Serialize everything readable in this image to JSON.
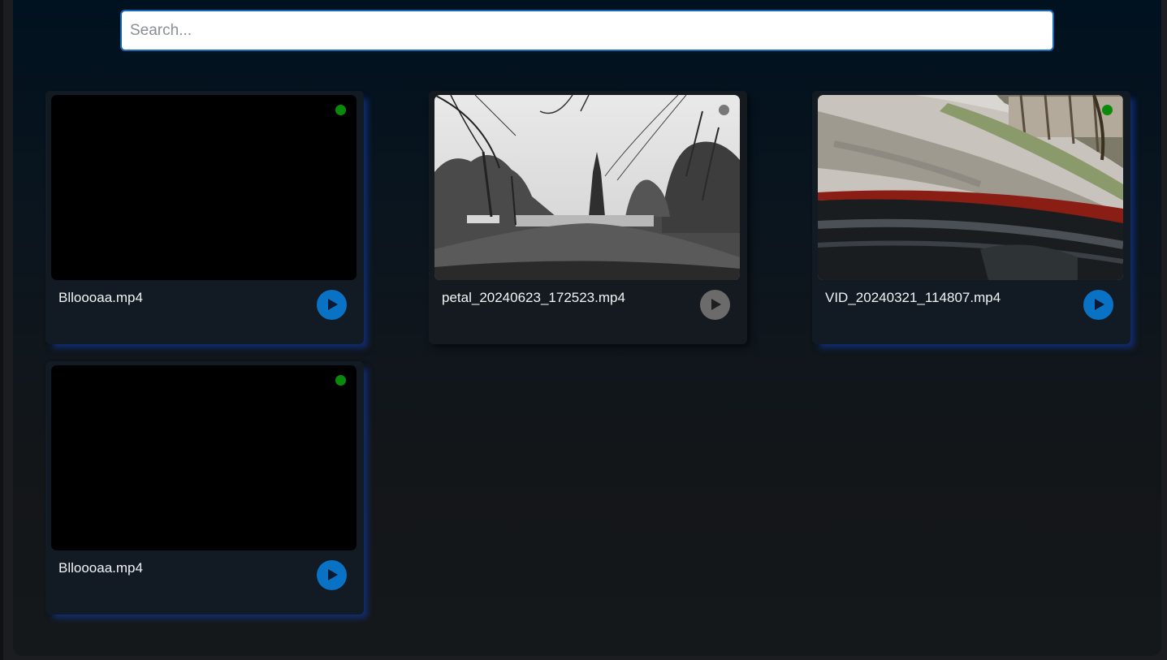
{
  "search": {
    "placeholder": "Search...",
    "value": ""
  },
  "videos": [
    {
      "name": "Blloooaa.mp4",
      "thumbnail": "black",
      "status_color": "#0a8a0a",
      "play_color": "#0a72c4",
      "active": true
    },
    {
      "name": "petal_20240623_172523.mp4",
      "thumbnail": "grayscale street scene",
      "status_color": "#777777",
      "play_color": "#6b6b6b",
      "active": false
    },
    {
      "name": "VID_20240321_114807.mp4",
      "thumbnail": "color street scene",
      "status_color": "#0a8a0a",
      "play_color": "#0a72c4",
      "active": true
    },
    {
      "name": "Blloooaa.mp4",
      "thumbnail": "black",
      "status_color": "#0a8a0a",
      "play_color": "#0a72c4",
      "active": true
    }
  ],
  "icons": {
    "play": "play-icon",
    "status": "status-dot-icon"
  }
}
